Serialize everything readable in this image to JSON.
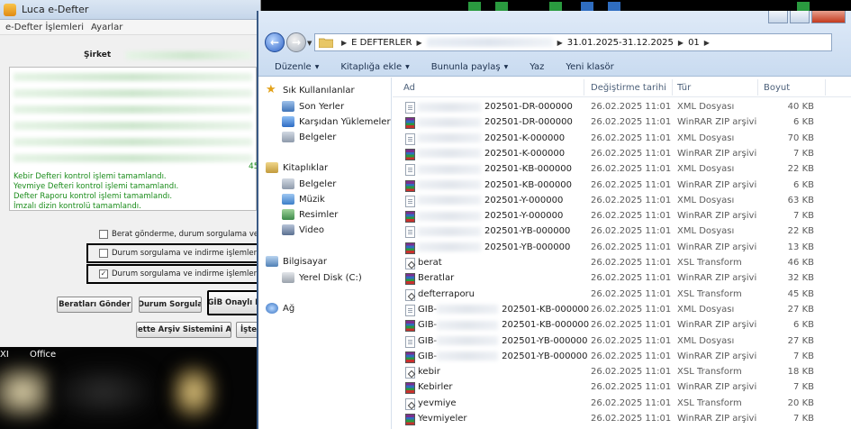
{
  "luca": {
    "title": "Luca e-Defter",
    "menu": [
      "e-Defter İşlemleri",
      "Ayarlar"
    ],
    "company_label": "Şirket",
    "log_lines": [
      "Kebir Defteri kontrol işlemi tamamlandı.",
      "Yevmiye Defteri kontrol işlemi tamamlandı.",
      "Defter Raporu kontrol işlemi tamamlandı.",
      "İmzalı dizin kontrolü tamamlandı."
    ],
    "side_number": "45",
    "checkbox_1": "Berat gönderme, durum sorgulama ve indirme",
    "checkbox_2": "Durum sorgulama ve indirme işlemleri Nette",
    "checkbox_3": "Durum sorgulama ve indirme işlemleri İşte D",
    "buttons": {
      "send": "Beratları Gönder",
      "status": "Durum Sorgula",
      "gib": "GİB Onaylı B",
      "nette": "Nette Arşiv Sistemini Aç",
      "iste": "İşte"
    }
  },
  "strip": {
    "label_left": "XI",
    "label_office": "Office"
  },
  "explorer": {
    "address": {
      "root": "E DEFTERLER",
      "period": "31.01.2025-31.12.2025",
      "month": "01"
    },
    "commands": {
      "organize": "Düzenle",
      "library": "Kitaplığa ekle",
      "share": "Bununla paylaş",
      "burn": "Yaz",
      "new_folder": "Yeni klasör"
    },
    "nav": {
      "favorites": "Sık Kullanılanlar",
      "recent": "Son Yerler",
      "downloads": "Karşıdan Yüklemeler",
      "docs": "Belgeler",
      "libraries": "Kitaplıklar",
      "lib_docs": "Belgeler",
      "music": "Müzik",
      "pictures": "Resimler",
      "video": "Video",
      "computer": "Bilgisayar",
      "local_disk": "Yerel Disk (C:)",
      "network": "Ağ"
    },
    "columns": {
      "name": "Ad",
      "date": "Değiştirme tarihi",
      "type": "Tür",
      "size": "Boyut"
    },
    "files": [
      {
        "name": "202501-DR-000000",
        "blur": 70,
        "icon": "xml",
        "date": "26.02.2025 11:01",
        "type": "XML Dosyası",
        "size": "40 KB"
      },
      {
        "name": "202501-DR-000000",
        "blur": 70,
        "icon": "zip",
        "date": "26.02.2025 11:01",
        "type": "WinRAR ZIP arşivi",
        "size": "6 KB"
      },
      {
        "name": "202501-K-000000",
        "blur": 70,
        "icon": "xml",
        "date": "26.02.2025 11:01",
        "type": "XML Dosyası",
        "size": "70 KB"
      },
      {
        "name": "202501-K-000000",
        "blur": 70,
        "icon": "zip",
        "date": "26.02.2025 11:01",
        "type": "WinRAR ZIP arşivi",
        "size": "7 KB"
      },
      {
        "name": "202501-KB-000000",
        "blur": 70,
        "icon": "xml",
        "date": "26.02.2025 11:01",
        "type": "XML Dosyası",
        "size": "22 KB"
      },
      {
        "name": "202501-KB-000000",
        "blur": 70,
        "icon": "zip",
        "date": "26.02.2025 11:01",
        "type": "WinRAR ZIP arşivi",
        "size": "6 KB"
      },
      {
        "name": "202501-Y-000000",
        "blur": 70,
        "icon": "xml",
        "date": "26.02.2025 11:01",
        "type": "XML Dosyası",
        "size": "63 KB"
      },
      {
        "name": "202501-Y-000000",
        "blur": 70,
        "icon": "zip",
        "date": "26.02.2025 11:01",
        "type": "WinRAR ZIP arşivi",
        "size": "7 KB"
      },
      {
        "name": "202501-YB-000000",
        "blur": 70,
        "icon": "xml",
        "date": "26.02.2025 11:01",
        "type": "XML Dosyası",
        "size": "22 KB"
      },
      {
        "name": "202501-YB-000000",
        "blur": 70,
        "icon": "zip",
        "date": "26.02.2025 11:01",
        "type": "WinRAR ZIP arşivi",
        "size": "13 KB"
      },
      {
        "name": "berat",
        "blur": 0,
        "icon": "xsl",
        "date": "26.02.2025 11:01",
        "type": "XSL Transform",
        "size": "46 KB"
      },
      {
        "name": "Beratlar",
        "blur": 0,
        "icon": "zip",
        "date": "26.02.2025 11:01",
        "type": "WinRAR ZIP arşivi",
        "size": "32 KB"
      },
      {
        "name": "defterraporu",
        "blur": 0,
        "icon": "xsl",
        "date": "26.02.2025 11:01",
        "type": "XSL Transform",
        "size": "45 KB"
      },
      {
        "name": "GIB-",
        "suffix": "202501-KB-000000",
        "blur": 68,
        "icon": "xml",
        "date": "26.02.2025 11:01",
        "type": "XML Dosyası",
        "size": "27 KB"
      },
      {
        "name": "GIB-",
        "suffix": "202501-KB-000000",
        "blur": 68,
        "icon": "zip",
        "date": "26.02.2025 11:01",
        "type": "WinRAR ZIP arşivi",
        "size": "6 KB"
      },
      {
        "name": "GIB-",
        "suffix": "202501-YB-000000",
        "blur": 68,
        "icon": "xml",
        "date": "26.02.2025 11:01",
        "type": "XML Dosyası",
        "size": "27 KB"
      },
      {
        "name": "GIB-",
        "suffix": "202501-YB-000000",
        "blur": 68,
        "icon": "zip",
        "date": "26.02.2025 11:01",
        "type": "WinRAR ZIP arşivi",
        "size": "7 KB"
      },
      {
        "name": "kebir",
        "blur": 0,
        "icon": "xsl",
        "date": "26.02.2025 11:01",
        "type": "XSL Transform",
        "size": "18 KB"
      },
      {
        "name": "Kebirler",
        "blur": 0,
        "icon": "zip",
        "date": "26.02.2025 11:01",
        "type": "WinRAR ZIP arşivi",
        "size": "7 KB"
      },
      {
        "name": "yevmiye",
        "blur": 0,
        "icon": "xsl",
        "date": "26.02.2025 11:01",
        "type": "XSL Transform",
        "size": "20 KB"
      },
      {
        "name": "Yevmiyeler",
        "blur": 0,
        "icon": "zip",
        "date": "26.02.2025 11:01",
        "type": "WinRAR ZIP arşivi",
        "size": "7 KB"
      }
    ]
  }
}
